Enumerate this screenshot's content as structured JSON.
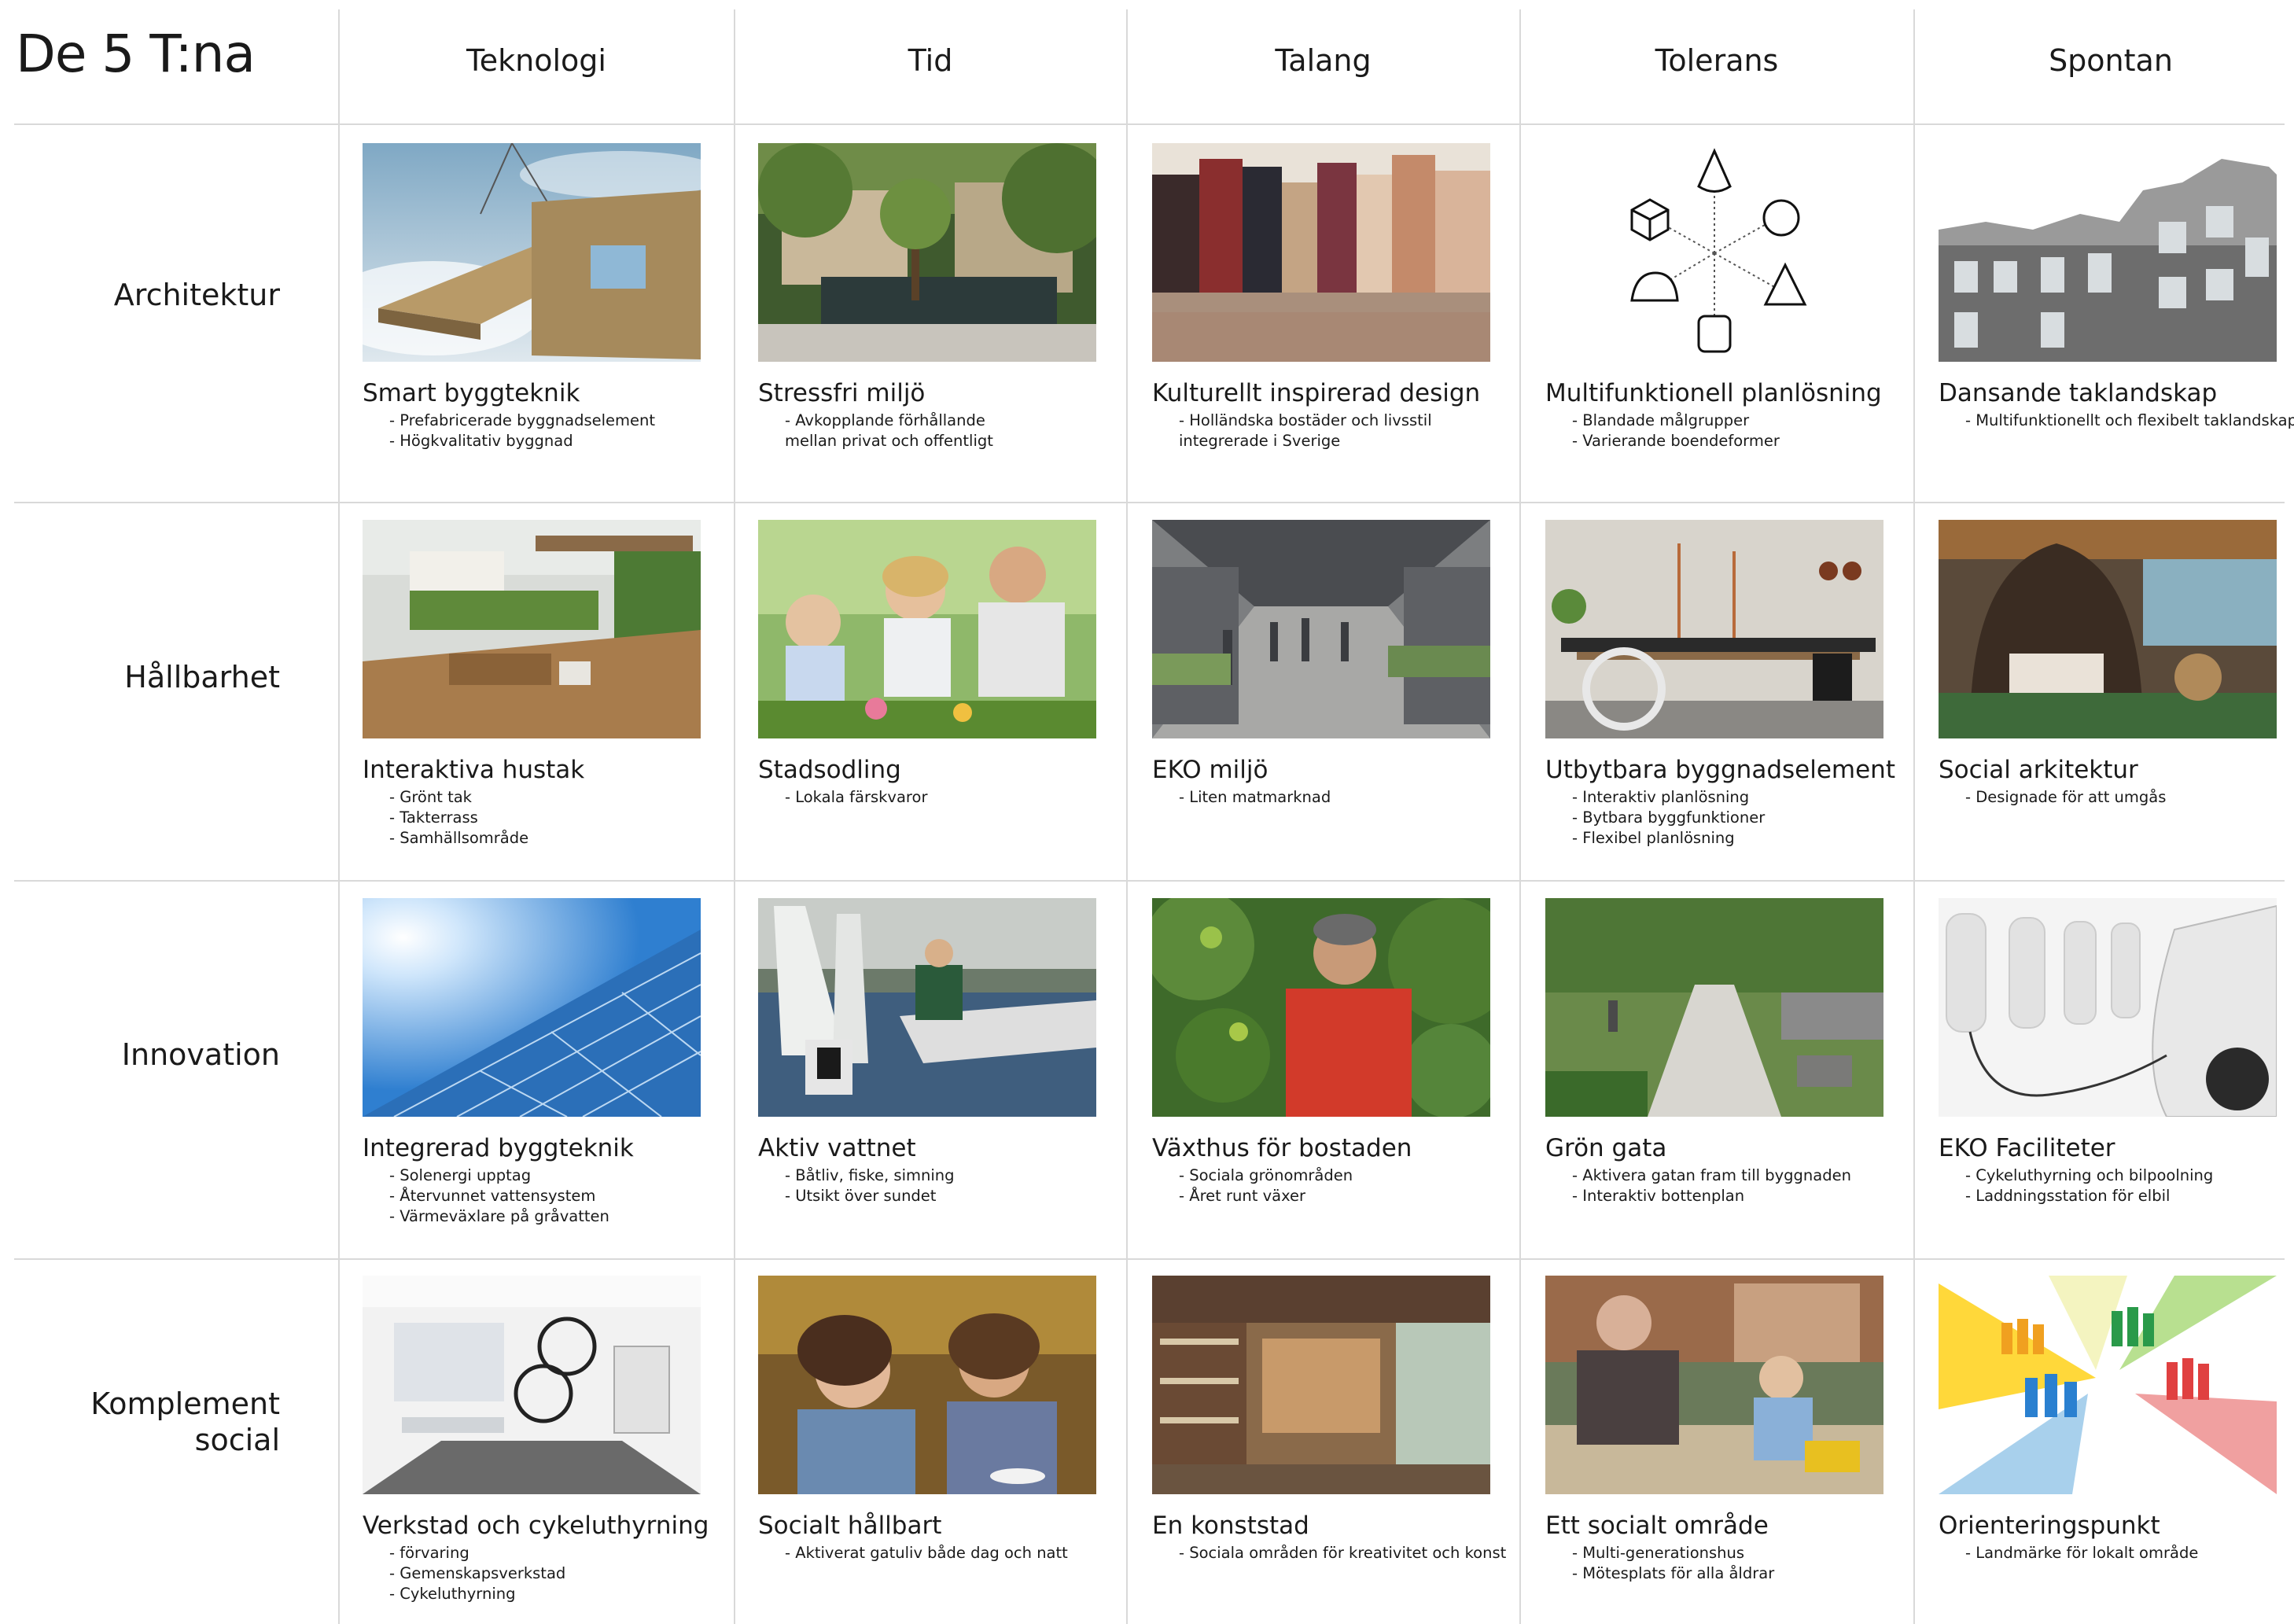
{
  "title": "De 5 T:na",
  "columns": [
    "Teknologi",
    "Tid",
    "Talang",
    "Tolerans",
    "Spontan"
  ],
  "rows": [
    {
      "label": "Architektur",
      "cells": [
        {
          "title": "Smart byggteknik",
          "bullets": [
            "- Prefabricerade byggnadselement",
            "- Högkvalitativ byggnad"
          ],
          "image": "prefab-wall-crane-image"
        },
        {
          "title": "Stressfri miljö",
          "bullets": [
            "- Avkopplande förhållande",
            "mellan privat och offentligt"
          ],
          "image": "courtyard-garden-image"
        },
        {
          "title": "Kulturellt inspirerad design",
          "bullets": [
            "- Holländska bostäder och livsstil",
            "integrerade i Sverige"
          ],
          "image": "dutch-canal-houses-image"
        },
        {
          "title": "Multifunktionell planlösning",
          "bullets": [
            "- Blandade målgrupper",
            "- Varierande boendeformer"
          ],
          "image": "geometric-shapes-diagram"
        },
        {
          "title": "Dansande taklandskap",
          "bullets": [
            "- Multifunktionellt och flexibelt taklandskap"
          ],
          "image": "building-facade-image"
        }
      ]
    },
    {
      "label": "Hållbarhet",
      "cells": [
        {
          "title": "Interaktiva hustak",
          "bullets": [
            "- Grönt tak",
            "- Takterrass",
            "- Samhällsområde"
          ],
          "image": "roof-terrace-image"
        },
        {
          "title": "Stadsodling",
          "bullets": [
            "- Lokala färskvaror"
          ],
          "image": "family-gardening-image"
        },
        {
          "title": "EKO miljö",
          "bullets": [
            "- Liten matmarknad"
          ],
          "image": "market-hall-image"
        },
        {
          "title": "Utbytbara byggnadselement",
          "bullets": [
            "- Interaktiv planlösning",
            "- Bytbara byggfunktioner",
            "- Flexibel planlösning"
          ],
          "image": "wheeled-kitchen-island-image"
        },
        {
          "title": "Social arkitektur",
          "bullets": [
            "- Designade för att umgås"
          ],
          "image": "lounge-interior-image"
        }
      ]
    },
    {
      "label": "Innovation",
      "cells": [
        {
          "title": "Integrerad byggteknik",
          "bullets": [
            "- Solenergi upptag",
            "- Återvunnet vattensystem",
            "- Värmeväxlare på gråvatten"
          ],
          "image": "solar-panels-image"
        },
        {
          "title": "Aktiv vattnet",
          "bullets": [
            "- Båtliv, fiske, simning",
            "- Utsikt över sundet"
          ],
          "image": "sailing-boats-image"
        },
        {
          "title": "Växthus för bostaden",
          "bullets": [
            "- Sociala grönområden",
            "- Året runt växer"
          ],
          "image": "greenhouse-gardener-image"
        },
        {
          "title": "Grön gata",
          "bullets": [
            "- Aktivera gatan fram till byggnaden",
            "- Interaktiv bottenplan"
          ],
          "image": "green-street-image"
        },
        {
          "title": "EKO Faciliteter",
          "bullets": [
            "- Cykeluthyrning och bilpoolning",
            "- Laddningsstation för elbil"
          ],
          "image": "ev-charging-image"
        }
      ]
    },
    {
      "label": [
        "Komplement",
        "social"
      ],
      "cells": [
        {
          "title": "Verkstad och cykeluthyrning",
          "bullets": [
            "- förvaring",
            "- Gemenskapsverkstad",
            "- Cykeluthyrning"
          ],
          "image": "bike-workshop-image"
        },
        {
          "title": "Socialt hållbart",
          "bullets": [
            "- Aktiverat gatuliv både dag och natt"
          ],
          "image": "cafe-friends-image"
        },
        {
          "title": "En konststad",
          "bullets": [
            "- Sociala områden för kreativitet och konst"
          ],
          "image": "art-studio-image"
        },
        {
          "title": "Ett socialt område",
          "bullets": [
            "- Multi-generationshus",
            "- Mötesplats för alla åldrar"
          ],
          "image": "grandparent-child-sandbox-image"
        },
        {
          "title": "Orienteringspunkt",
          "bullets": [
            "- Landmärke för lokalt område"
          ],
          "image": "people-arrows-graphic"
        }
      ]
    }
  ]
}
